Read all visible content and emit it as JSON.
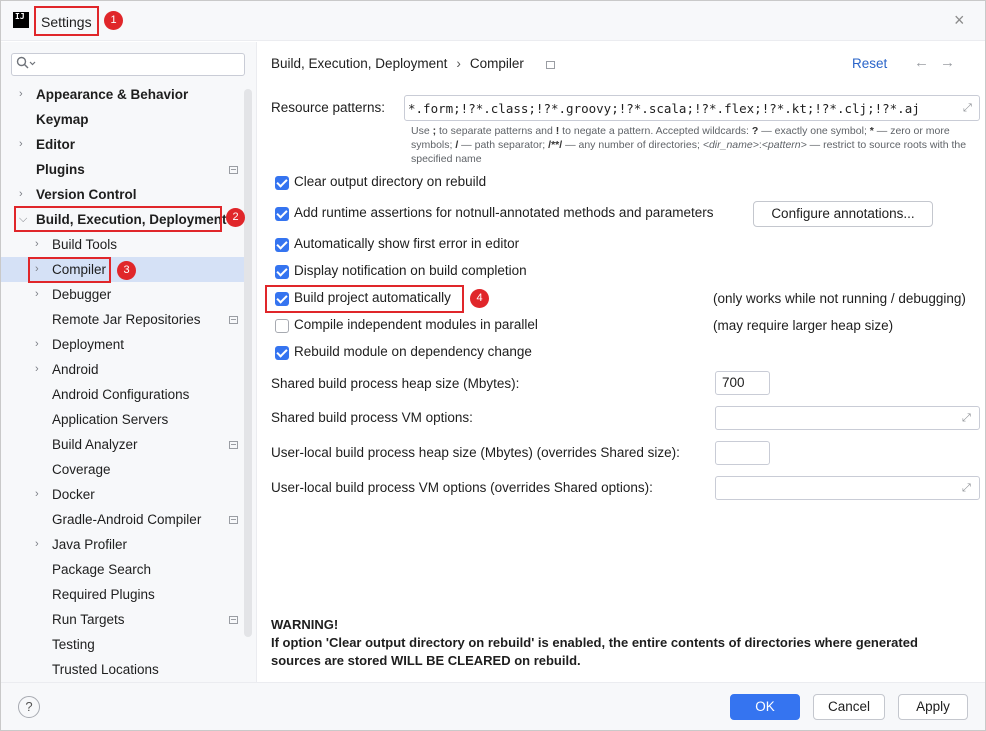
{
  "window": {
    "logo_text": "IJ",
    "title": "Settings",
    "close": "×"
  },
  "badges": [
    "1",
    "2",
    "3",
    "4"
  ],
  "sidebar": {
    "search_placeholder": "",
    "items": [
      {
        "label": "Appearance & Behavior",
        "expandable": true,
        "level": 0
      },
      {
        "label": "Keymap",
        "expandable": false,
        "level": 0
      },
      {
        "label": "Editor",
        "expandable": true,
        "level": 0
      },
      {
        "label": "Plugins",
        "expandable": false,
        "level": 0
      },
      {
        "label": "Version Control",
        "expandable": true,
        "level": 0
      },
      {
        "label": "Build, Execution, Deployment",
        "expandable": true,
        "expanded": true,
        "level": 0
      },
      {
        "label": "Build Tools",
        "expandable": true,
        "level": 1
      },
      {
        "label": "Compiler",
        "expandable": true,
        "level": 1,
        "selected": true
      },
      {
        "label": "Debugger",
        "expandable": true,
        "level": 1
      },
      {
        "label": "Remote Jar Repositories",
        "expandable": false,
        "level": 1
      },
      {
        "label": "Deployment",
        "expandable": true,
        "level": 1
      },
      {
        "label": "Android",
        "expandable": true,
        "level": 1
      },
      {
        "label": "Android Configurations",
        "expandable": false,
        "level": 1
      },
      {
        "label": "Application Servers",
        "expandable": false,
        "level": 1
      },
      {
        "label": "Build Analyzer",
        "expandable": false,
        "level": 1
      },
      {
        "label": "Coverage",
        "expandable": false,
        "level": 1
      },
      {
        "label": "Docker",
        "expandable": true,
        "level": 1
      },
      {
        "label": "Gradle-Android Compiler",
        "expandable": false,
        "level": 1
      },
      {
        "label": "Java Profiler",
        "expandable": true,
        "level": 1
      },
      {
        "label": "Package Search",
        "expandable": false,
        "level": 1
      },
      {
        "label": "Required Plugins",
        "expandable": false,
        "level": 1
      },
      {
        "label": "Run Targets",
        "expandable": false,
        "level": 1
      },
      {
        "label": "Testing",
        "expandable": false,
        "level": 1
      },
      {
        "label": "Trusted Locations",
        "expandable": false,
        "level": 1
      }
    ]
  },
  "main": {
    "breadcrumb": [
      "Build, Execution, Deployment",
      "Compiler"
    ],
    "breadcrumb_sep": "›",
    "reset": "Reset",
    "nav_back": "←",
    "nav_forward": "→",
    "resource_patterns_label": "Resource patterns:",
    "resource_patterns_value": "*.form;!?*.class;!?*.groovy;!?*.scala;!?*.flex;!?*.kt;!?*.clj;!?*.aj",
    "hint": {
      "a": "Use ",
      "b": ";",
      "c": " to separate patterns and ",
      "d": "!",
      "e": " to negate a pattern. Accepted wildcards: ",
      "f": "?",
      "g": " — exactly one symbol; ",
      "h": "*",
      "i": " — zero or more symbols; ",
      "j": "/",
      "k": " — path separator; ",
      "l": "/**/",
      "m": " — any number of directories; ",
      "n": "<dir_name>",
      "o": ":",
      "p": "<pattern>",
      "q": " — restrict to source roots with the specified name"
    },
    "options": [
      {
        "label": "Clear output directory on rebuild",
        "checked": true
      },
      {
        "label": "Add runtime assertions for notnull-annotated methods and parameters",
        "checked": true
      },
      {
        "label": "Automatically show first error in editor",
        "checked": true
      },
      {
        "label": "Display notification on build completion",
        "checked": true
      },
      {
        "label": "Build project automatically",
        "checked": true
      },
      {
        "label": "Compile independent modules in parallel",
        "checked": false
      },
      {
        "label": "Rebuild module on dependency change",
        "checked": true
      }
    ],
    "configure_annotations": "Configure annotations...",
    "note_build_auto": "(only works while not running / debugging)",
    "note_parallel": "(may require larger heap size)",
    "heap_label": "Shared build process heap size (Mbytes):",
    "heap_value": "700",
    "vm_label": "Shared build process VM options:",
    "user_heap_label": "User-local build process heap size (Mbytes) (overrides Shared size):",
    "user_vm_label": "User-local build process VM options (overrides Shared options):",
    "warning_title": "WARNING!",
    "warning_text": "If option 'Clear output directory on rebuild' is enabled, the entire contents of directories where generated sources are stored WILL BE CLEARED on rebuild."
  },
  "footer": {
    "help": "?",
    "ok": "OK",
    "cancel": "Cancel",
    "apply": "Apply"
  },
  "colors": {
    "accent": "#3574f0",
    "annotation_red": "#e0262a",
    "selection": "#d5e1f6",
    "link": "#2a64c9"
  }
}
